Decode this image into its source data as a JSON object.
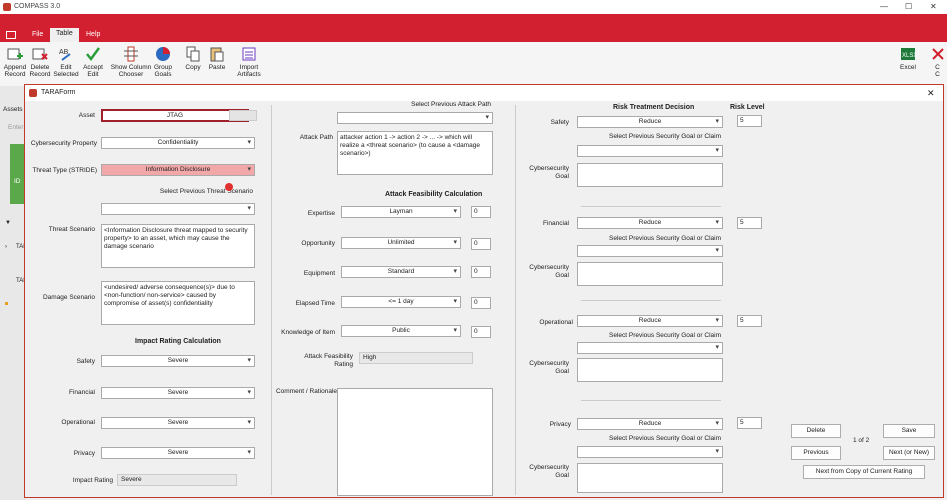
{
  "app": {
    "title": "COMPASS 3.0"
  },
  "menu": {
    "file": "File",
    "table": "Table",
    "help": "Help"
  },
  "ribbon": [
    {
      "label1": "Append",
      "label2": "Record"
    },
    {
      "label1": "Delete",
      "label2": "Record"
    },
    {
      "label1": "Edit",
      "label2": "Selected"
    },
    {
      "label1": "Accept",
      "label2": "Edit"
    },
    {
      "label1": "Show Column",
      "label2": "Chooser"
    },
    {
      "label1": "Group",
      "label2": "Goals"
    },
    {
      "label1": "Copy",
      "label2": ""
    },
    {
      "label1": "Paste",
      "label2": ""
    },
    {
      "label1": "Import",
      "label2": "Artifacts"
    },
    {
      "label1": "Excel",
      "label2": ""
    },
    {
      "label1": "C",
      "label2": "C"
    }
  ],
  "left": {
    "assets": "Assets",
    "enter": "Enter",
    "id": "ID",
    "ta1": "TAF",
    "ta2": "TAF"
  },
  "form": {
    "title": "TARAForm",
    "asset_label": "Asset",
    "asset": "JTAG",
    "cyber_prop_label": "Cybersecurity Property",
    "cyber_prop": "Confidentiality",
    "threat_type_label": "Threat Type (STRIDE)",
    "threat_type": "Information Disclosure",
    "prev_threat_label": "Select Previous Threat Scenario",
    "threat_scenario_label": "Threat Scenario",
    "threat_scenario": "<Information Disclosure threat mapped to security property> to an asset, which may cause the damage scenario",
    "damage_scenario_label": "Damage Scenario",
    "damage_scenario": "<undesired/ adverse consequence(s)> due to <non-function/ non-service> caused by compromise of asset(s) confidentiality",
    "impact_header": "Impact Rating Calculation",
    "safety_label": "Safety",
    "safety": "Severe",
    "financial_label": "Financial",
    "financial": "Severe",
    "operational_label": "Operational",
    "operational": "Severe",
    "privacy_label": "Privacy",
    "privacy": "Severe",
    "impact_rating_label": "Impact Rating",
    "impact_rating": "Severe",
    "prev_attack_label": "Select Previous Attack Path",
    "attack_path_label": "Attack Path",
    "attack_path": "attacker action 1 -> action 2 -> ... -> which will realize a <threat scenario> (to cause a <damage scenario>)",
    "feas_header": "Attack Feasibility Calculation",
    "expertise_label": "Expertise",
    "expertise": "Layman",
    "expertise_val": "0",
    "opportunity_label": "Opportunity",
    "opportunity": "Unlimited",
    "opportunity_val": "0",
    "equipment_label": "Equipment",
    "equipment": "Standard",
    "equipment_val": "0",
    "elapsed_label": "Elapsed Time",
    "elapsed": "<= 1 day",
    "elapsed_val": "0",
    "knowledge_label": "Knowledge of Item",
    "knowledge": "Public",
    "knowledge_val": "0",
    "afr_label": "Attack Feasibility Rating",
    "afr": "High",
    "comment_label": "Comment / Rationale",
    "rtd_header": "Risk Treatment Decision",
    "risk_level_header": "Risk Level",
    "prev_goal_label": "Select Previous Security Goal or Claim",
    "cyber_goal_label": "Cybersecurity Goal",
    "treat": [
      {
        "label": "Safety",
        "value": "Reduce",
        "risk": "5"
      },
      {
        "label": "Financial",
        "value": "Reduce",
        "risk": "5"
      },
      {
        "label": "Operational",
        "value": "Reduce",
        "risk": "5"
      },
      {
        "label": "Privacy",
        "value": "Reduce",
        "risk": "5"
      }
    ],
    "buttons": {
      "delete": "Delete",
      "save": "Save",
      "previous": "Previous",
      "next": "Next (or New)",
      "page": "1 of 2",
      "next_copy": "Next from Copy of Current Rating"
    }
  }
}
